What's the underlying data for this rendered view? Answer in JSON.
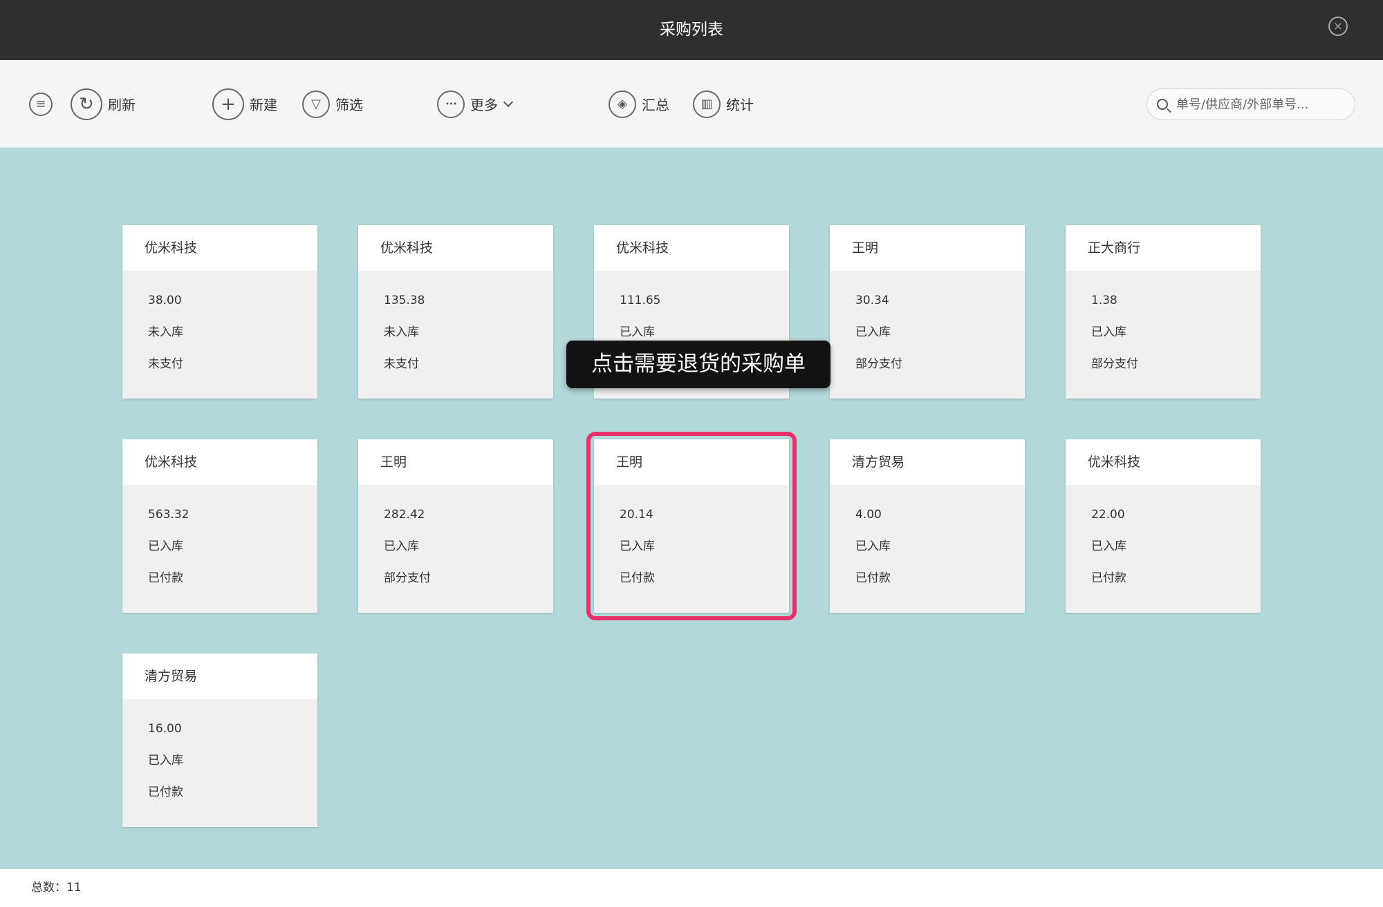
{
  "window": {
    "title": "采购列表",
    "close_icon": "×"
  },
  "toolbar": {
    "menu_icon": "≡",
    "refresh_icon": "↻",
    "refresh": "刷新",
    "new_icon": "+",
    "new": "新建",
    "filter_icon": "▽",
    "filter": "筛选",
    "more_icon": "•••",
    "more": "更多",
    "summary_icon": "◈",
    "summary": "汇总",
    "stats_icon": "▥",
    "stats": "统计"
  },
  "search": {
    "placeholder": "单号/供应商/外部单号..."
  },
  "cards": [
    {
      "supplier": "优米科技",
      "amount": "38.00",
      "stock_status": "未入库",
      "payment_status": "未支付"
    },
    {
      "supplier": "优米科技",
      "amount": "135.38",
      "stock_status": "未入库",
      "payment_status": "未支付"
    },
    {
      "supplier": "优米科技",
      "amount": "111.65",
      "stock_status": "已入库",
      "payment_status": ""
    },
    {
      "supplier": "王明",
      "amount": "30.34",
      "stock_status": "已入库",
      "payment_status": "部分支付"
    },
    {
      "supplier": "正大商行",
      "amount": "1.38",
      "stock_status": "已入库",
      "payment_status": "部分支付"
    },
    {
      "supplier": "优米科技",
      "amount": "563.32",
      "stock_status": "已入库",
      "payment_status": "已付款"
    },
    {
      "supplier": "王明",
      "amount": "282.42",
      "stock_status": "已入库",
      "payment_status": "部分支付"
    },
    {
      "supplier": "王明",
      "amount": "20.14",
      "stock_status": "已入库",
      "payment_status": "已付款"
    },
    {
      "supplier": "清方贸易",
      "amount": "4.00",
      "stock_status": "已入库",
      "payment_status": "已付款"
    },
    {
      "supplier": "优米科技",
      "amount": "22.00",
      "stock_status": "已入库",
      "payment_status": "已付款"
    },
    {
      "supplier": "清方贸易",
      "amount": "16.00",
      "stock_status": "已入库",
      "payment_status": "已付款"
    }
  ],
  "tooltip": {
    "text": "点击需要退货的采购单"
  },
  "footer": {
    "total": "总数：11"
  },
  "colors": {
    "highlight": "#e8306a",
    "background": "#b3d8d9",
    "titlebar": "#2f2f2f"
  }
}
